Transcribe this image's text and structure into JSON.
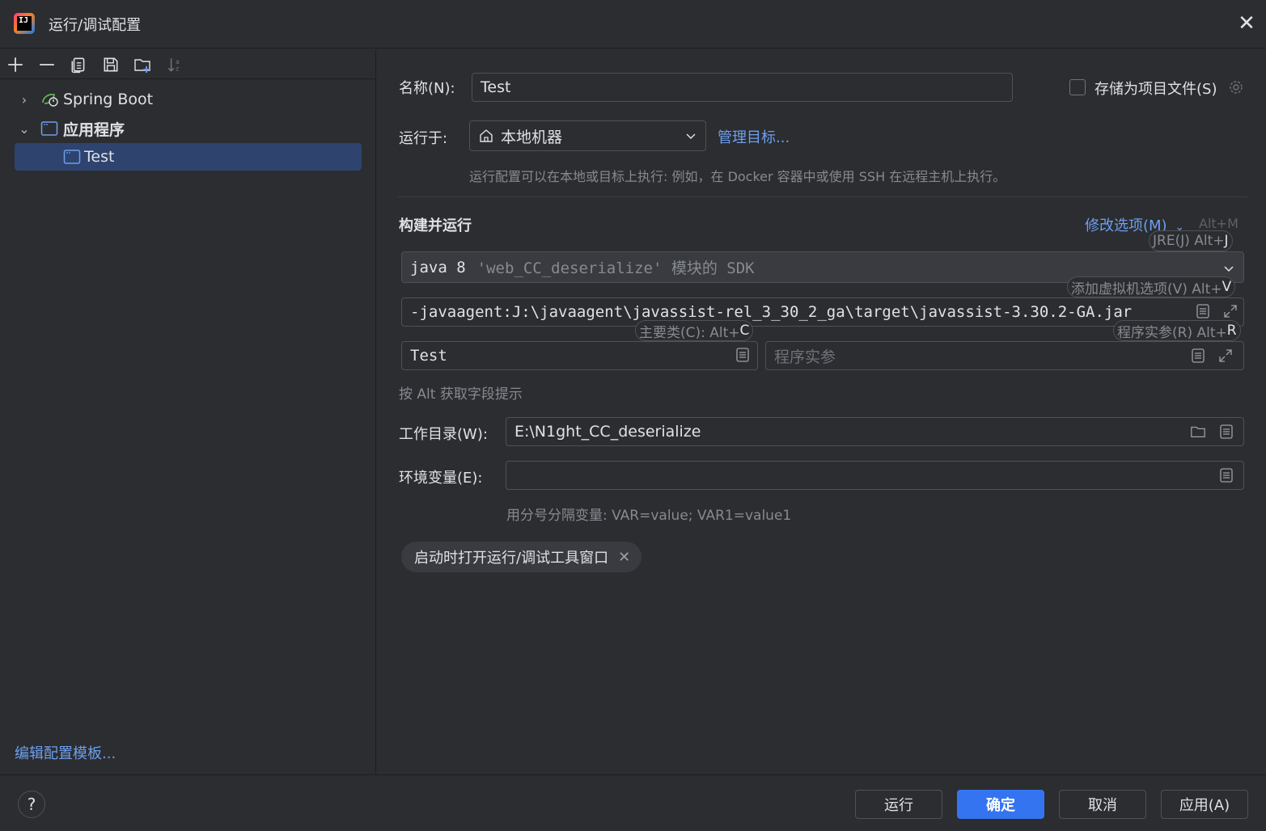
{
  "window": {
    "title": "运行/调试配置"
  },
  "toolbar": {
    "icons": [
      "add-icon",
      "remove-icon",
      "copy-icon",
      "save-icon",
      "new-folder-icon",
      "sort-icon"
    ]
  },
  "tree": {
    "items": [
      {
        "label": "Spring Boot",
        "expanded": false,
        "icon": "spring-boot-icon"
      },
      {
        "label": "应用程序",
        "expanded": true,
        "icon": "application-icon"
      },
      {
        "label": "Test",
        "selected": true,
        "icon": "application-icon"
      }
    ],
    "edit_templates": "编辑配置模板..."
  },
  "form": {
    "name_label": "名称(N):",
    "name_value": "Test",
    "store_as_project_file": "存储为项目文件(S)",
    "store_checked": false,
    "run_on_label": "运行于:",
    "run_on_value": "本地机器",
    "manage_targets": "管理目标...",
    "run_on_hint": "运行配置可以在本地或目标上执行: 例如，在 Docker 容器中或使用 SSH 在远程主机上执行。",
    "build_run_title": "构建并运行",
    "modify_options": "修改选项(M)",
    "modify_options_shortcut": "Alt+M",
    "sdk_java": "java 8",
    "sdk_module": "'web_CC_deserialize' 模块的 SDK",
    "vm_options": "-javaagent:J:\\javaagent\\javassist-rel_3_30_2_ga\\target\\javassist-3.30.2-GA.jar",
    "main_class": "Test",
    "program_args_placeholder": "程序实参",
    "alt_hint": "按 Alt 获取字段提示",
    "workdir_label": "工作目录(W):",
    "workdir_value": "E:\\N1ght_CC_deserialize",
    "env_label": "环境变量(E):",
    "env_value": "",
    "env_hint": "用分号分隔变量: VAR=value; VAR1=value1",
    "chip_label": "启动时打开运行/调试工具窗口"
  },
  "tooltips": {
    "jre": {
      "text": "JRE(J) Alt+",
      "key": "J"
    },
    "vm": {
      "text": "添加虚拟机选项(V) Alt+",
      "key": "V"
    },
    "main": {
      "text": "主要类(C): Alt+",
      "key": "C"
    },
    "args": {
      "text": "程序实参(R) Alt+",
      "key": "R"
    }
  },
  "buttons": {
    "help": "?",
    "run": "运行",
    "ok": "确定",
    "cancel": "取消",
    "apply": "应用(A)"
  },
  "colors": {
    "background": "#2b2d30",
    "accent": "#3574f0",
    "link": "#6e9fee",
    "selection": "#2e436e"
  }
}
